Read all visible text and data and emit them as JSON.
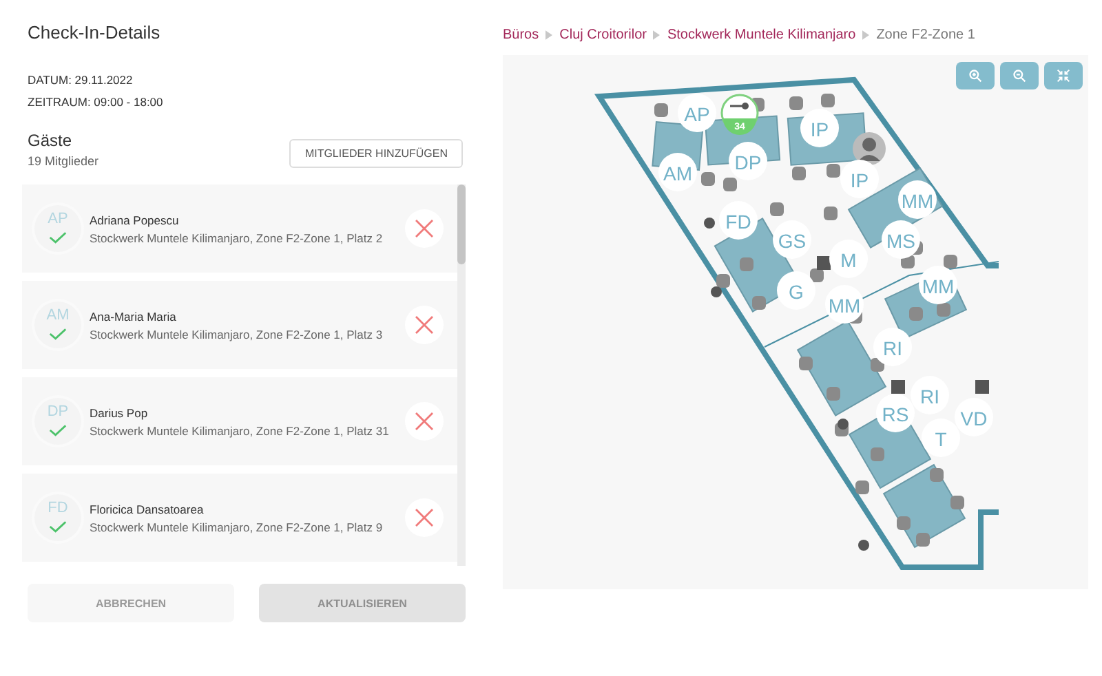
{
  "title": "Check-In-Details",
  "date": "DATUM: 29.11.2022",
  "timespan": "ZEITRAUM: 09:00 - 18:00",
  "guests": {
    "heading": "Gäste",
    "count": "19 Mitglieder",
    "add_button": "MITGLIEDER HINZUFÜGEN",
    "items": [
      {
        "initials": "AP",
        "name": "Adriana Popescu",
        "place": "Stockwerk Muntele Kilimanjaro, Zone F2-Zone 1, Platz 2",
        "checked": true
      },
      {
        "initials": "AM",
        "name": "Ana-Maria Maria",
        "place": "Stockwerk Muntele Kilimanjaro, Zone F2-Zone 1, Platz 3",
        "checked": true
      },
      {
        "initials": "DP",
        "name": "Darius Pop",
        "place": "Stockwerk Muntele Kilimanjaro, Zone F2-Zone 1, Platz 31",
        "checked": true
      },
      {
        "initials": "FD",
        "name": "Floricica Dansatoarea",
        "place": "Stockwerk Muntele Kilimanjaro, Zone F2-Zone 1, Platz 9",
        "checked": true
      }
    ]
  },
  "buttons": [
    {
      "label": "ABBRECHEN",
      "disabled": false
    },
    {
      "label": "AKTUALISIEREN",
      "disabled": true
    }
  ],
  "breadcrumb": [
    {
      "label": "Büros",
      "current": false
    },
    {
      "label": "Cluj Croitorilor",
      "current": false
    },
    {
      "label": "Stockwerk Muntele Kilimanjaro",
      "current": false
    },
    {
      "label": "Zone F2-Zone 1",
      "current": true
    }
  ],
  "map": {
    "markers": [
      {
        "kind": "initials",
        "label": "AP"
      },
      {
        "kind": "key",
        "label": "34"
      },
      {
        "kind": "initials",
        "label": "IP"
      },
      {
        "kind": "initials",
        "label": "AM"
      },
      {
        "kind": "initials",
        "label": "DP"
      },
      {
        "kind": "photo"
      },
      {
        "kind": "initials",
        "label": "IP"
      },
      {
        "kind": "initials",
        "label": "MM"
      },
      {
        "kind": "initials",
        "label": "FD"
      },
      {
        "kind": "initials",
        "label": "GS"
      },
      {
        "kind": "initials",
        "label": "MS"
      },
      {
        "kind": "initials",
        "label": "M"
      },
      {
        "kind": "initials",
        "label": "MM"
      },
      {
        "kind": "initials",
        "label": "G"
      },
      {
        "kind": "initials",
        "label": "MM"
      },
      {
        "kind": "initials",
        "label": "RI"
      },
      {
        "kind": "initials",
        "label": "RI"
      },
      {
        "kind": "initials",
        "label": "RS"
      },
      {
        "kind": "initials",
        "label": "VD"
      },
      {
        "kind": "initials",
        "label": "T"
      }
    ]
  }
}
